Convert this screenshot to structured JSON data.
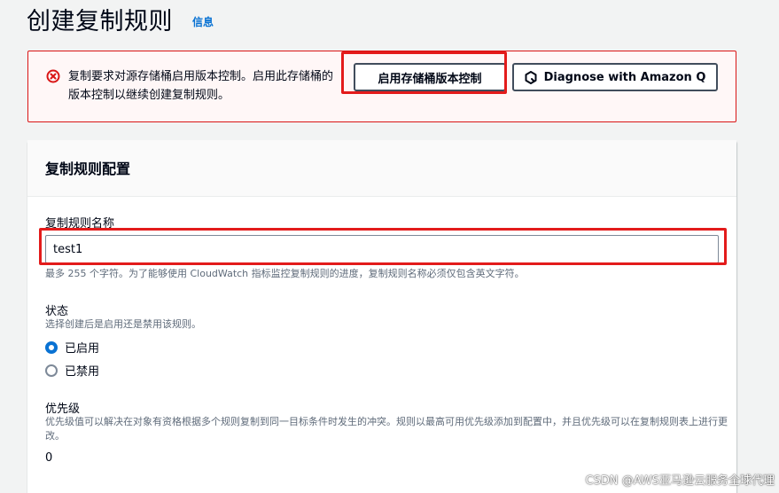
{
  "header": {
    "title": "创建复制规则",
    "info_link": "信息"
  },
  "alert": {
    "icon": "error-circle-icon",
    "message": "复制要求对源存储桶启用版本控制。启用此存储桶的版本控制以继续创建复制规则。",
    "enable_versioning_label": "启用存储桶版本控制",
    "diagnose_label": "Diagnose with Amazon Q",
    "colors": {
      "border": "#d91515",
      "background": "#fff7f7"
    }
  },
  "config": {
    "section_title": "复制规则配置",
    "rule_name": {
      "label": "复制规则名称",
      "value": "test1",
      "description": "最多 255 个字符。为了能够使用 CloudWatch 指标监控复制规则的进度，复制规则名称必须仅包含英文字符。"
    },
    "status": {
      "label": "状态",
      "description": "选择创建后是启用还是禁用该规则。",
      "options": [
        {
          "label": "已启用",
          "checked": true
        },
        {
          "label": "已禁用",
          "checked": false
        }
      ]
    },
    "priority": {
      "label": "优先级",
      "description": "优先级值可以解决在对象有资格根据多个规则复制到同一目标条件时发生的冲突。规则以最高可用优先级添加到配置中，并且优先级可以在复制规则表上进行更改。",
      "value": "0"
    }
  },
  "watermark": "CSDN @AWS亚马逊云服务全球代理",
  "colors": {
    "accent": "#0972d3",
    "highlight": "#e31b1b"
  }
}
